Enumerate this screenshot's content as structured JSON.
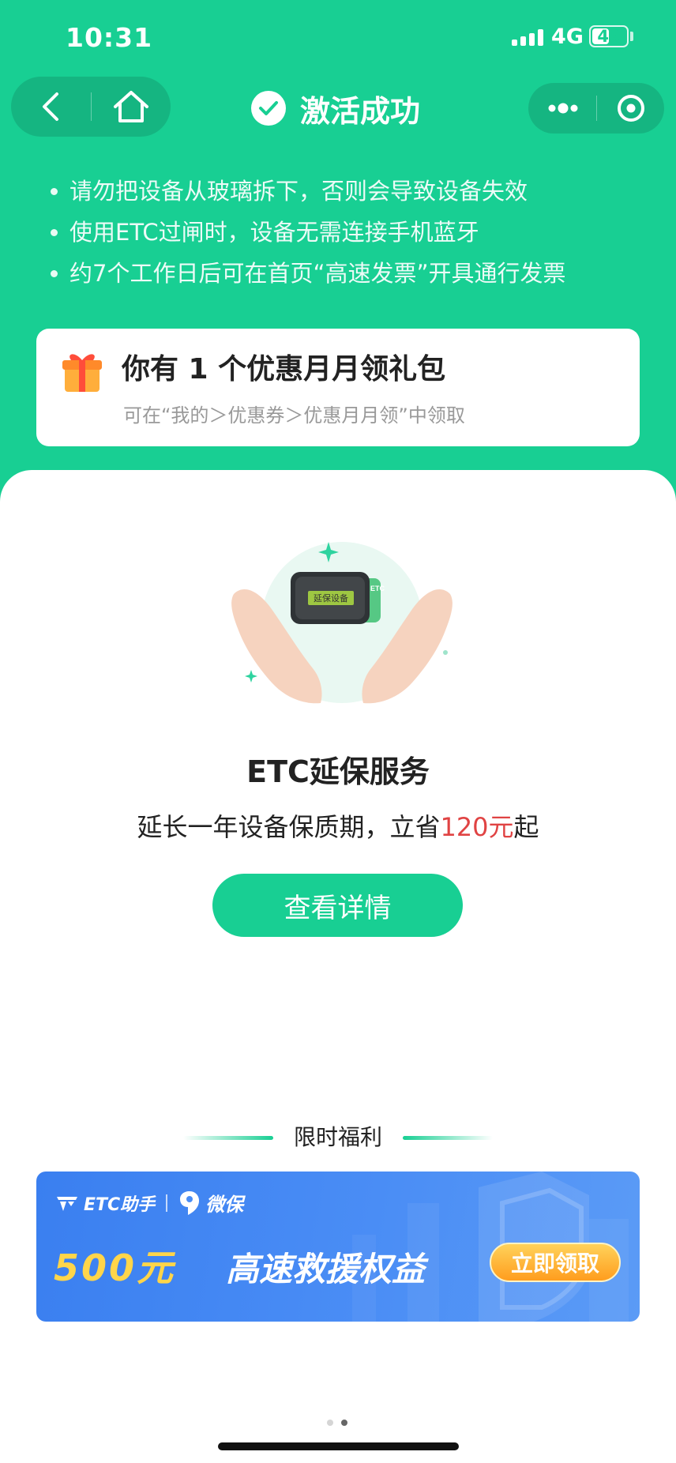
{
  "status_bar": {
    "time": "10:31",
    "network": "4G",
    "battery_level": "49",
    "battery_fraction": 0.49
  },
  "nav": {
    "title": "激活成功",
    "back_icon": "chevron-left-icon",
    "home_icon": "home-icon",
    "more_icon": "more-dots-icon",
    "close_icon": "target-close-icon"
  },
  "tips": [
    "请勿把设备从玻璃拆下，否则会导致设备失效",
    "使用ETC过闸时，设备无需连接手机蓝牙",
    "约7个工作日后可在首页“高速发票”开具通行发票"
  ],
  "gift": {
    "icon": "gift-icon",
    "title": "你有 1 个优惠月月领礼包",
    "subtitle": "可在“我的＞优惠券＞优惠月月领”中领取"
  },
  "service": {
    "device_label": "延保设备",
    "device_brand": "ETC",
    "title": "ETC延保服务",
    "desc_prefix": "延长一年设备保质期，立省",
    "desc_highlight": "120元",
    "desc_suffix": "起",
    "button": "查看详情"
  },
  "benefits": {
    "section_title": "限时福利",
    "banner": {
      "brand_etc": "ETC助手",
      "brand_wb": "微保",
      "amount": "500元",
      "headline": "高速救援权益",
      "cta": "立即领取"
    }
  },
  "pager": {
    "count": 2,
    "active_index": 1
  },
  "colors": {
    "primary": "#18cf93",
    "highlight": "#e04343",
    "banner_blue": "#4a8df5",
    "banner_gold": "#ffd54a"
  }
}
